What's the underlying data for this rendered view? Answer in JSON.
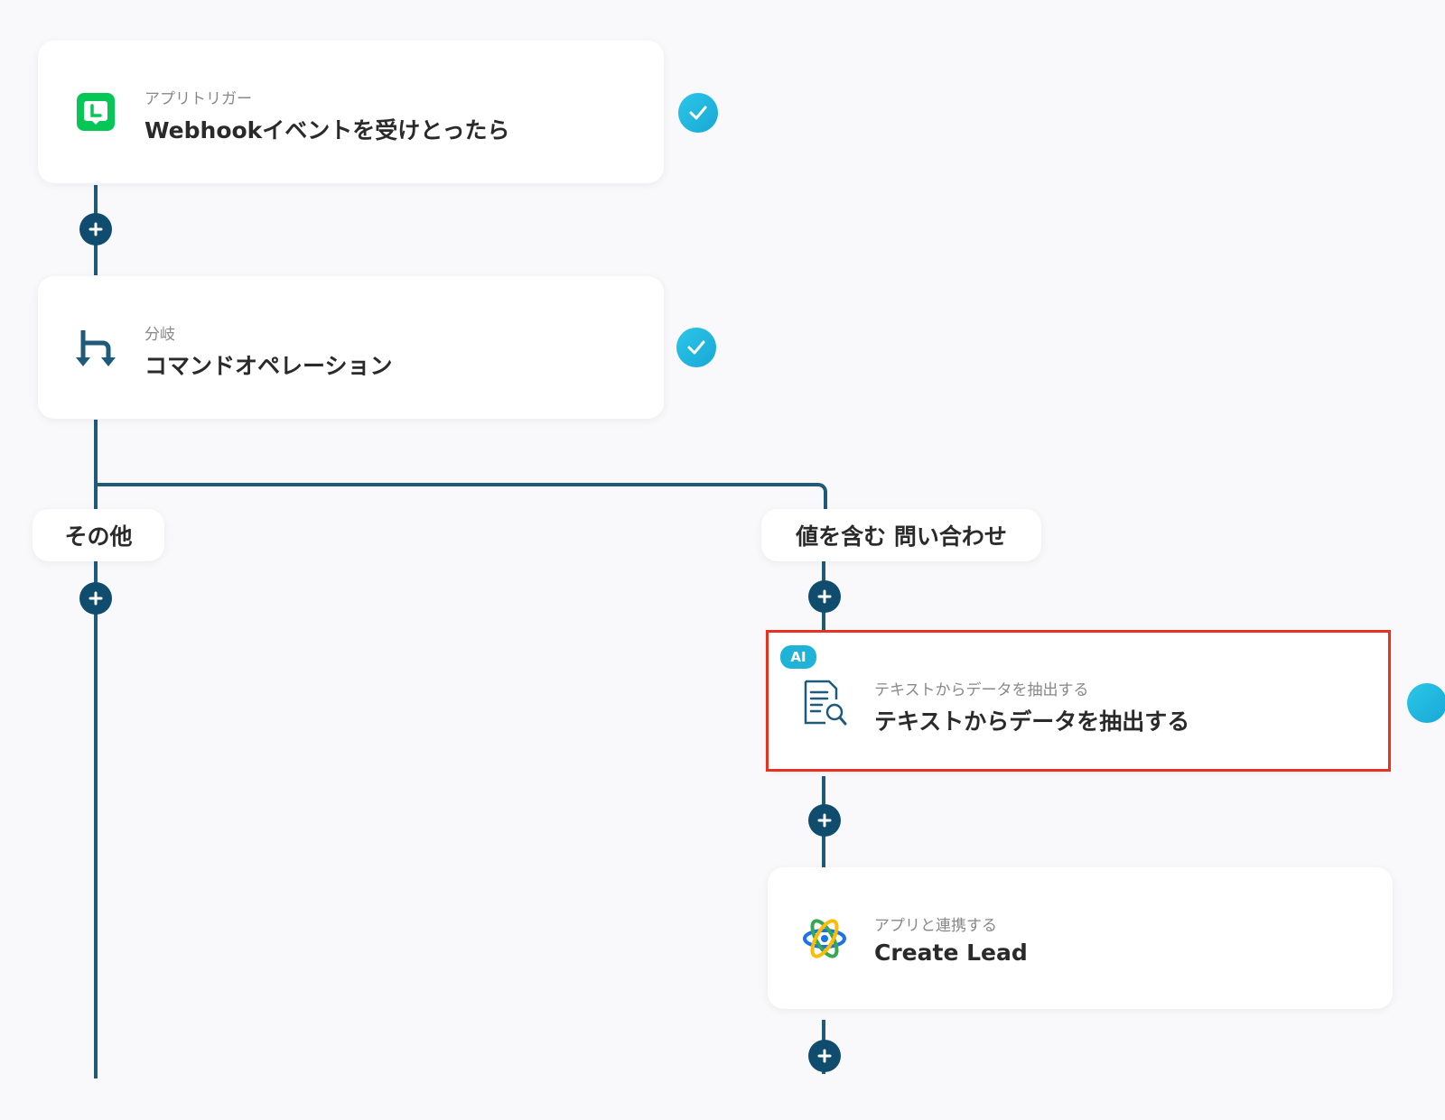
{
  "flow": {
    "trigger": {
      "subtitle": "アプリトリガー",
      "title": "Webhookイベントを受けとったら",
      "icon": "line-app-icon",
      "status": "completed"
    },
    "branch": {
      "subtitle": "分岐",
      "title": "コマンドオペレーション",
      "icon": "branch-icon",
      "status": "completed"
    },
    "branches": {
      "left_label": "その他",
      "right_label": "値を含む 問い合わせ"
    },
    "extract": {
      "badge": "AI",
      "subtitle": "テキストからデータを抽出する",
      "title": "テキストからデータを抽出する",
      "icon": "document-search-icon",
      "highlighted": true
    },
    "create_lead": {
      "subtitle": "アプリと連携する",
      "title": "Create Lead",
      "icon": "orbit-app-icon"
    }
  },
  "colors": {
    "connector": "#1e5a7a",
    "plus_button": "#0f4c6e",
    "check": "#1fb3d8",
    "highlight": "#e8321e",
    "line_app": "#06c755"
  }
}
